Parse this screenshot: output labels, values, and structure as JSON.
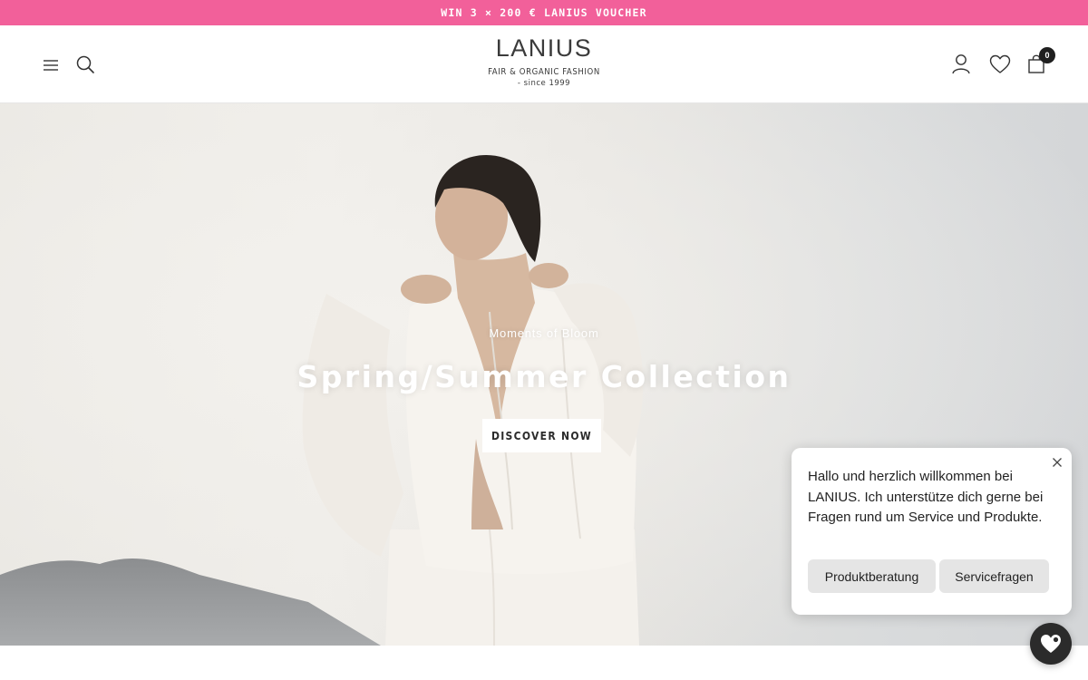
{
  "announcement": {
    "text": "WIN 3 × 200 € LANIUS VOUCHER"
  },
  "header": {
    "logo": {
      "wordmark": "LANIUS",
      "tagline": "FAIR & ORGANIC FASHION",
      "since": "- since 1999"
    },
    "icons": [
      "menu-icon",
      "search-icon",
      "account-icon",
      "heart-icon",
      "bag-icon"
    ],
    "cart_count": "0"
  },
  "hero": {
    "kicker": "Moments of Bloom",
    "title": "Spring/Summer Collection",
    "cta_label": "DISCOVER NOW"
  },
  "chat": {
    "message": "Hallo und herzlich willkommen bei LANIUS. Ich unterstütze dich gerne bei Fragen rund um Service und Produkte.",
    "buttons": [
      "Produktberatung",
      "Servicefragen"
    ]
  },
  "colors": {
    "announcement_bg": "#f2609a",
    "text_dark": "#2b2b2b",
    "chat_button_bg": "#e5e5e5",
    "launcher_bg": "#2b2b2b"
  }
}
